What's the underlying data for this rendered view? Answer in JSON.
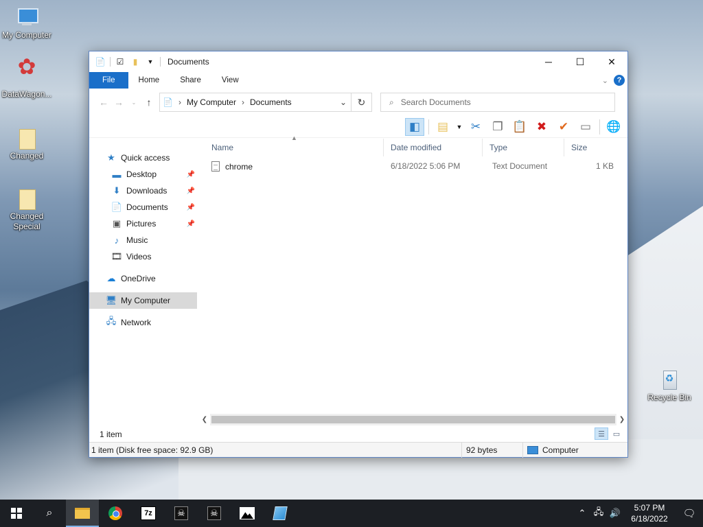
{
  "desktop": {
    "icons": [
      {
        "label": "My Computer",
        "icon": "computer-icon"
      },
      {
        "label": "DataWagon...",
        "icon": "flower-icon"
      },
      {
        "label": "Changed",
        "icon": "folder-icon"
      },
      {
        "label": "Changed Special",
        "icon": "folder-icon"
      },
      {
        "label": "Recycle Bin",
        "icon": "recycle-bin-icon"
      }
    ]
  },
  "explorer": {
    "title": "Documents",
    "ribbon_tabs": [
      "File",
      "Home",
      "Share",
      "View"
    ],
    "help_label": "?",
    "breadcrumb": [
      "My Computer",
      "Documents"
    ],
    "search_placeholder": "Search Documents",
    "nav": {
      "quick_access": "Quick access",
      "quick_items": [
        "Desktop",
        "Downloads",
        "Documents",
        "Pictures",
        "Music",
        "Videos"
      ],
      "onedrive": "OneDrive",
      "my_computer": "My Computer",
      "network": "Network"
    },
    "columns": [
      "Name",
      "Date modified",
      "Type",
      "Size"
    ],
    "files": [
      {
        "name": "chrome",
        "date": "6/18/2022 5:06 PM",
        "type": "Text Document",
        "size": "1 KB"
      }
    ],
    "item_count": "1 item",
    "status": {
      "main": "1 item (Disk free space: 92.9 GB)",
      "size": "92 bytes",
      "zone": "Computer"
    }
  },
  "taskbar": {
    "apps": [
      "file-explorer",
      "chrome",
      "7-zip",
      "ghost-app-1",
      "ghost-app-2",
      "photos",
      "notepad"
    ],
    "app_7z_label": "7z",
    "time": "5:07 PM",
    "date": "6/18/2022"
  },
  "colors": {
    "accent": "#1a6fc9",
    "selection": "#cce4f7",
    "taskbar": "#1c1f24"
  }
}
